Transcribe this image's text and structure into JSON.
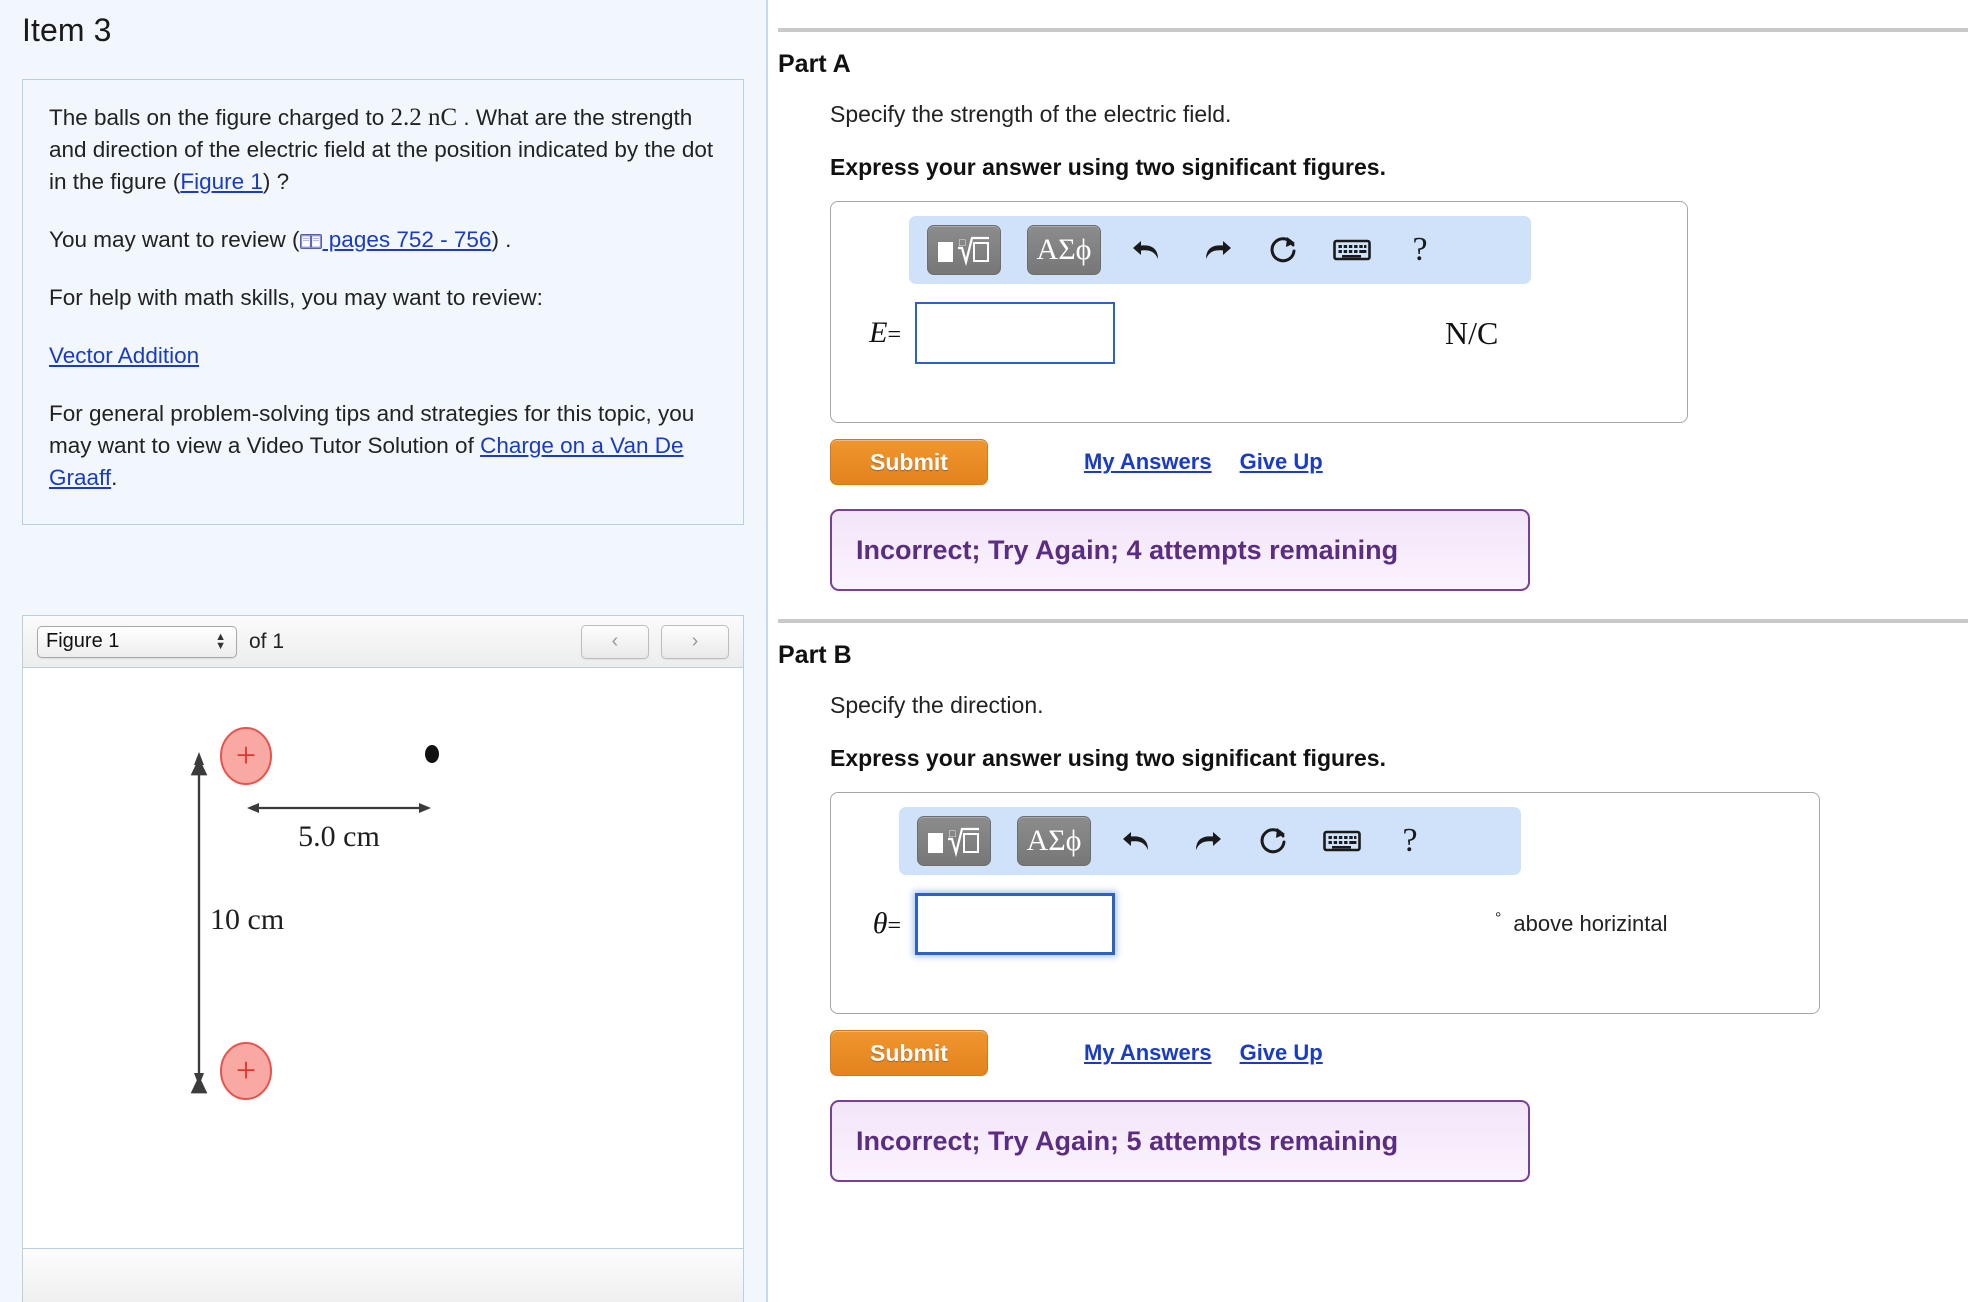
{
  "item": {
    "title": "Item 3",
    "problem_lines": {
      "l1_a": "The balls on the figure charged to ",
      "l1_q": "2.2 nC",
      "l1_b": " . What are the strength and direction of the electric field at the position indicated by the dot in the figure (",
      "l1_link": "Figure 1",
      "l1_c": ") ?",
      "l2_a": "You may want to review (",
      "l2_link": " pages 752 - 756",
      "l2_b": ") .",
      "l3": "For help with math skills, you may want to review:",
      "l4_link": "Vector Addition",
      "l5_a": "For general problem-solving tips and strategies for this topic, you may want to view a Video Tutor Solution of ",
      "l5_link": "Charge on a Van De Graaff",
      "l5_b": "."
    }
  },
  "figure": {
    "selected": "Figure 1",
    "of_label": "of 1",
    "prev_label": "‹",
    "next_label": "›",
    "diagram": {
      "horizontal_label": "5.0 cm",
      "vertical_label": "10 cm",
      "charge_sign": "+",
      "charge_count": 2,
      "field_point": "dot"
    }
  },
  "parts": [
    {
      "id": "A",
      "title": "Part A",
      "prompt": "Specify the strength of the electric field.",
      "express": "Express your answer using two significant figures.",
      "variable": "E",
      "equals": "=",
      "value": "",
      "unit": "N/C",
      "unit_suffix": "",
      "focused": false,
      "submit_label": "Submit",
      "my_answers_label": "My Answers",
      "give_up_label": "Give Up",
      "feedback": "Incorrect; Try Again; 4 attempts remaining",
      "toolbar": {
        "template_button": "math-template",
        "greek_button": "ΑΣϕ",
        "undo": "undo-icon",
        "redo": "redo-icon",
        "reset": "reset-icon",
        "keyboard": "keyboard-icon",
        "help": "?"
      }
    },
    {
      "id": "B",
      "title": "Part B",
      "prompt": "Specify the direction.",
      "express": "Express your answer using two significant figures.",
      "variable": "θ",
      "equals": "=",
      "value": "",
      "unit": "°",
      "unit_suffix": "above horizintal",
      "focused": true,
      "submit_label": "Submit",
      "my_answers_label": "My Answers",
      "give_up_label": "Give Up",
      "feedback": "Incorrect; Try Again; 5 attempts remaining",
      "toolbar": {
        "template_button": "math-template",
        "greek_button": "ΑΣϕ",
        "undo": "undo-icon",
        "redo": "redo-icon",
        "reset": "reset-icon",
        "keyboard": "keyboard-icon",
        "help": "?"
      }
    }
  ],
  "colors": {
    "submit_orange": "#e3831d",
    "link_blue": "#1a3bc4",
    "feedback_purple": "#5b2d82",
    "toolbar_blue": "#cfe2f9",
    "panel_bg": "#f2f7fd",
    "charge_red": "#f09a96"
  }
}
